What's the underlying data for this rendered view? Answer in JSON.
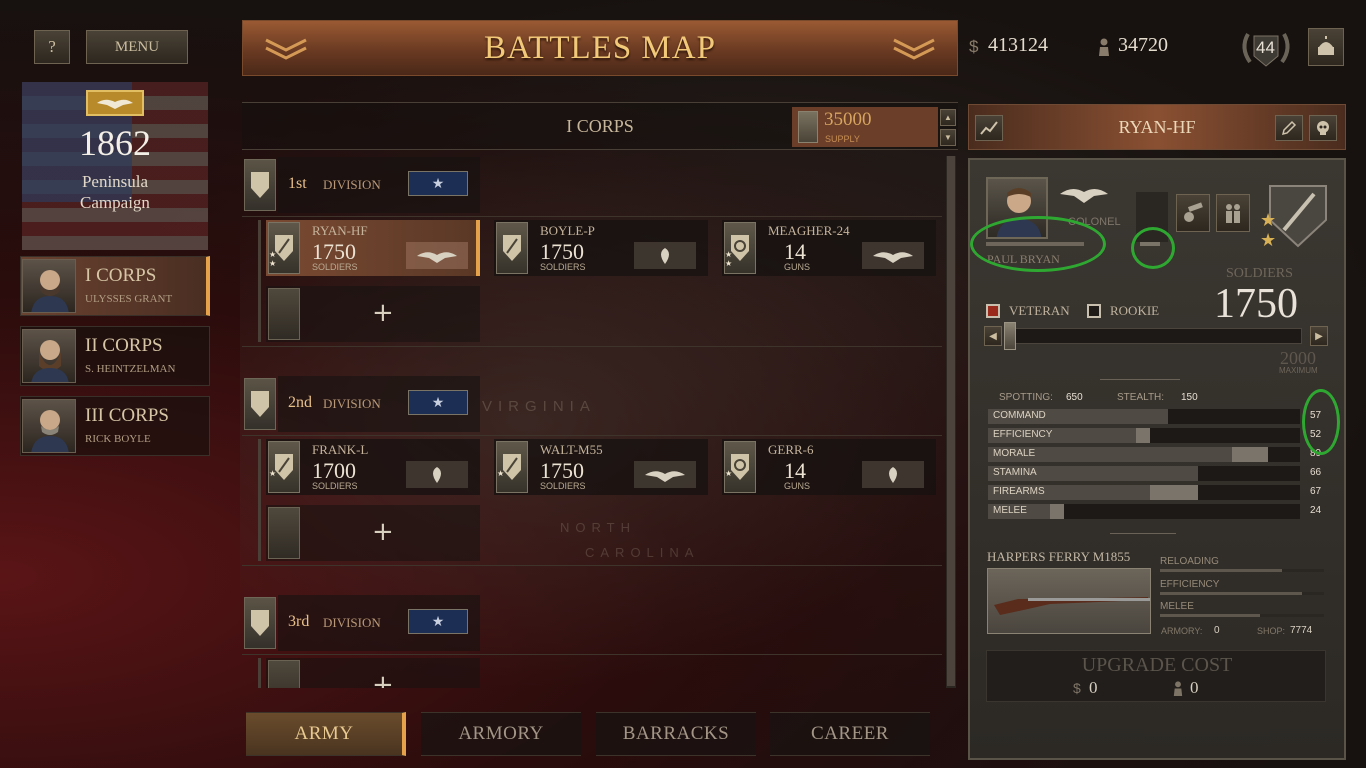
{
  "topbar": {
    "help_label": "?",
    "menu_label": "MENU",
    "title": "BATTLES MAP",
    "money_symbol": "$",
    "money": "413124",
    "manpower": "34720",
    "level": "44"
  },
  "campaign": {
    "year": "1862",
    "name_line1": "Peninsula",
    "name_line2": "Campaign"
  },
  "corps_list": [
    {
      "name": "I CORPS",
      "commander": "ULYSSES GRANT"
    },
    {
      "name": "II CORPS",
      "commander": "S. HEINTZELMAN"
    },
    {
      "name": "III CORPS",
      "commander": "RICK BOYLE"
    }
  ],
  "corps_header": {
    "name": "I CORPS",
    "supply": "35000",
    "supply_label": "SUPPLY"
  },
  "divisions": [
    {
      "number": "1st",
      "label": "DIVISION",
      "units": [
        {
          "name": "RYAN-HF",
          "count": "1750",
          "type": "SOLDIERS"
        },
        {
          "name": "BOYLE-P",
          "count": "1750",
          "type": "SOLDIERS"
        },
        {
          "name": "MEAGHER-24",
          "count": "14",
          "type": "GUNS"
        }
      ]
    },
    {
      "number": "2nd",
      "label": "DIVISION",
      "units": [
        {
          "name": "FRANK-L",
          "count": "1700",
          "type": "SOLDIERS"
        },
        {
          "name": "WALT-M55",
          "count": "1750",
          "type": "SOLDIERS"
        },
        {
          "name": "GERR-6",
          "count": "14",
          "type": "GUNS"
        }
      ]
    },
    {
      "number": "3rd",
      "label": "DIVISION",
      "units": []
    }
  ],
  "add_symbol": "+",
  "map_labels": [
    "VIRGINIA",
    "NORTH",
    "CAROLINA"
  ],
  "tabs": [
    "ARMY",
    "ARMORY",
    "BARRACKS",
    "CAREER"
  ],
  "unit_panel": {
    "title": "RYAN-HF",
    "officer_name": "PAUL BRYAN",
    "officer_rank": "COLONEL",
    "soldiers_label": "SOLDIERS",
    "soldiers": "1750",
    "veteran_label": "VETERAN",
    "rookie_label": "ROOKIE",
    "max_value": "2000",
    "max_label": "MAXIMUM",
    "spotting_label": "SPOTTING:",
    "spotting": "650",
    "stealth_label": "STEALTH:",
    "stealth": "150",
    "stats": [
      {
        "label": "COMMAND",
        "value": "57"
      },
      {
        "label": "EFFICIENCY",
        "value": "52"
      },
      {
        "label": "MORALE",
        "value": "89"
      },
      {
        "label": "STAMINA",
        "value": "66"
      },
      {
        "label": "FIREARMS",
        "value": "67"
      },
      {
        "label": "MELEE",
        "value": "24"
      }
    ],
    "weapon_name": "HARPERS FERRY M1855",
    "weapon_stats": [
      "RELOADING",
      "EFFICIENCY",
      "MELEE"
    ],
    "armory_label": "ARMORY:",
    "armory": "0",
    "shop_label": "SHOP:",
    "shop": "7774",
    "upgrade_label": "UPGRADE COST",
    "upgrade_money": "0",
    "upgrade_men": "0"
  },
  "colors": {
    "accent": "#e5a24a",
    "annotation": "#2fa832",
    "title_text": "#f2c978"
  }
}
